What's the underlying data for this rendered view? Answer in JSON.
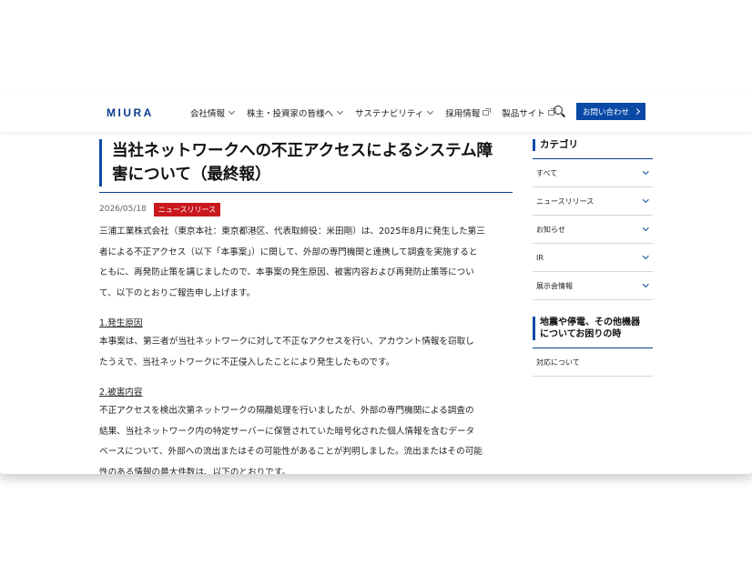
{
  "header": {
    "logo_text": "MIURA",
    "nav": [
      {
        "label": "会社情報",
        "type": "dropdown"
      },
      {
        "label": "株主・投資家の皆様へ",
        "type": "dropdown"
      },
      {
        "label": "サステナビリティ",
        "type": "dropdown"
      },
      {
        "label": "採用情報",
        "type": "external"
      },
      {
        "label": "製品サイト",
        "type": "external"
      }
    ],
    "search_icon": "search-icon",
    "contact_label": "お問い合わせ"
  },
  "article": {
    "title_line1": "当社ネットワークへの不正アクセスによるシステム障",
    "title_line2": "害について（最終報）",
    "date": "2026/05/18",
    "badge": "ニュースリリース",
    "intro": [
      "三浦工業株式会社（東京本社：東京都港区、代表取締役：米田剛）は、2025年8月に発生した第三",
      "者による不正アクセス（以下「本事案」）に関して、外部の専門機関と連携して調査を実施すると",
      "ともに、再発防止策を講じましたので、本事案の発生原因、被害内容および再発防止策等につい",
      "て、以下のとおりご報告申し上げます。"
    ],
    "section1_heading": "1.発生原因",
    "section1": [
      "本事案は、第三者が当社ネットワークに対して不正なアクセスを行い、アカウント情報を窃取し",
      "たうえで、当社ネットワークに不正侵入したことにより発生したものです。"
    ],
    "section2_heading": "2.被害内容",
    "section2": [
      "不正アクセスを検出次第ネットワークの隔離処理を行いましたが、外部の専門機関による調査の",
      "結果、当社ネットワーク内の特定サーバーに保管されていた暗号化された個人情報を含むデータ",
      "ベースについて、外部への流出またはその可能性があることが判明しました。流出またはその可能",
      "性のある情報の最大件数は、以下のとおりです。"
    ]
  },
  "sidebar": {
    "category_title": "カテゴリ",
    "categories": [
      "すべて",
      "ニュースリリース",
      "お知らせ",
      "IR",
      "展示会情報"
    ],
    "disaster_title_line1": "地震や停電、その他機器",
    "disaster_title_line2": "についてお困りの時",
    "disaster_link": "対応について"
  },
  "colors": {
    "brand_blue": "#0a4aa6",
    "badge_red": "#c9191e"
  }
}
